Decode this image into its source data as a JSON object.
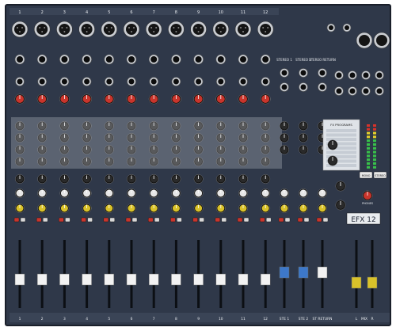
{
  "channels": {
    "numbers": [
      "1",
      "2",
      "3",
      "4",
      "5",
      "6",
      "7",
      "8",
      "9",
      "10",
      "11",
      "12"
    ]
  },
  "stereo_returns": {
    "labels": [
      "STEREO 1",
      "STEREO 2",
      "STEREO RETURN"
    ]
  },
  "bottom_strip_labels": [
    "1",
    "2",
    "3",
    "4",
    "5",
    "6",
    "7",
    "8",
    "9",
    "10",
    "11",
    "12",
    "STE 1",
    "STE 2",
    "ST RETURN",
    "L",
    "MIX",
    "R"
  ],
  "master_section": {
    "brand": "EFX 12",
    "fx_label": "EFX",
    "mode_labels": [
      "MONO",
      "STEREO"
    ],
    "fx_program_label": "FX PROGRAMS",
    "phones_label": "PHONES"
  },
  "colors": {
    "panel": "#2f3849",
    "knob_red": "#c9352c",
    "knob_yellow": "#d9c22a",
    "knob_blue": "#3d78c9",
    "eq_area": "#cfd4da",
    "led_green": "#38c24a",
    "led_yellow": "#e6d12b",
    "led_red": "#d7332b"
  }
}
